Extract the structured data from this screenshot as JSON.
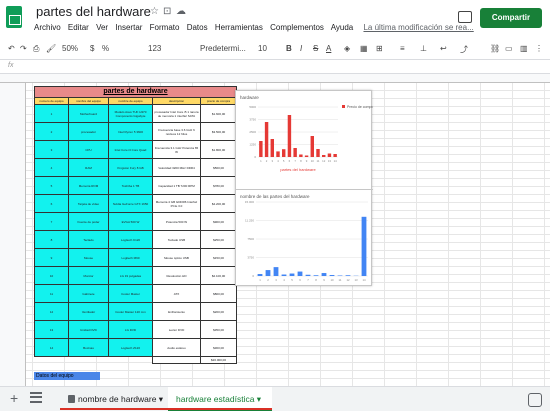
{
  "app": {
    "title": "partes del hardware",
    "share_label": "Compartir"
  },
  "menu": [
    "Archivo",
    "Editar",
    "Ver",
    "Insertar",
    "Formato",
    "Datos",
    "Herramientas",
    "Complementos",
    "Ayuda"
  ],
  "last_edit": "La última modificación se rea...",
  "toolbar": {
    "zoom": "50%",
    "currency": "$",
    "percent": "%",
    ".0": ".0",
    ".00": ".00",
    "format_num": "123",
    "font": "Predetermi...",
    "font_size": "10",
    "bold": "B",
    "italic": "I",
    "strike": "S",
    "text_color": "A"
  },
  "formula": {
    "fx": "fx",
    "value": ""
  },
  "columns": [
    "A",
    "B",
    "C",
    "D",
    "E",
    "F",
    "G",
    "H",
    "I",
    "J",
    "K",
    "L",
    "M",
    "N",
    "O",
    "P"
  ],
  "rows": [
    "1",
    "2",
    "3",
    "4",
    "5",
    "6",
    "7",
    "8",
    "9",
    "10",
    "11",
    "12",
    "13",
    "14",
    "15",
    "16",
    "17",
    "18",
    "19",
    "20",
    "21",
    "22",
    "23",
    "24",
    "25",
    "26",
    "27",
    "28",
    "29",
    "30",
    "31",
    "32",
    "33",
    "34",
    "35",
    "36",
    "37"
  ],
  "table": {
    "title": "partes de hardware",
    "headers": [
      "numero de equipo",
      "nombre del equipo",
      "nombre de equipo",
      "descripcion",
      "precio de compra"
    ],
    "rows": [
      [
        "1",
        "Motherboard",
        "Modelo Asus TUF H370 Components Gigabyte",
        "procesador Intel Core i5 1 ranura de memoria 1 interfaz SATA",
        "$1.600,00"
      ],
      [
        "2",
        "procesador",
        "Intel Ryzen 5 3600",
        "Frecuencia base 3.6 GHz 6 núcleos 12 hilos",
        "$3.500,00"
      ],
      [
        "3",
        "CPU",
        "Intel Core i3 Core Quad",
        "Frecuencia 3.1 GHz Potencia 65 W",
        "$1.800,00"
      ],
      [
        "4",
        "RAM",
        "Kingston Fury 8 GB",
        "Velocidad 3200 MHz DDR4",
        "$560,00"
      ],
      [
        "5",
        "Memoria ROM",
        "Toshiba 1 TB",
        "Capacidad 1 TB 7200 RPM",
        "$780,00"
      ],
      [
        "6",
        "Tarjeta de video",
        "Nvidia GeForce GTX 1650",
        "Memoria 4 GB GDDR6 Interfaz PCIe 3.0",
        "$4.200,00"
      ],
      [
        "7",
        "Fuente de poder",
        "EVGA 500 W",
        "Potencia 500 W",
        "$900,00"
      ],
      [
        "8",
        "Teclado",
        "Logitech K120",
        "Teclado USB",
        "$250,00"
      ],
      [
        "9",
        "Mouse",
        "Logitech M90",
        "Mouse óptico USB",
        "$150,00"
      ],
      [
        "10",
        "Monitor",
        "LG 19 pulgadas",
        "Resolución HD",
        "$2.100,00"
      ],
      [
        "11",
        "Gabinete",
        "Cooler Master",
        "ATX",
        "$800,00"
      ],
      [
        "12",
        "Ventilador",
        "Cooler Master 120 mm",
        "Enfriamiento",
        "$200,00"
      ],
      [
        "13",
        "Unidad DVD",
        "LG DVD",
        "Lector DVD",
        "$350,00"
      ],
      [
        "14",
        "Bocinas",
        "Logitech Z120",
        "Audio estéreo",
        "$300,00"
      ]
    ],
    "total": "$20.000,00"
  },
  "datos_label": "Datos del equipo",
  "chart_data": [
    {
      "type": "bar",
      "title": "hardware",
      "series": [
        {
          "name": "Precio de compra",
          "values": [
            1600,
            3500,
            1800,
            560,
            780,
            4200,
            900,
            250,
            150,
            2100,
            800,
            200,
            350,
            300
          ]
        }
      ],
      "categories": [
        "1",
        "2",
        "3",
        "4",
        "5",
        "6",
        "7",
        "8",
        "9",
        "10",
        "11",
        "12",
        "13",
        "14"
      ],
      "xlabel": "partes del hardware",
      "ylabel": "",
      "ylim": [
        0,
        5000
      ],
      "color": "#e53935"
    },
    {
      "type": "bar",
      "title": "nombre de las partes del hardware",
      "series": [
        {
          "name": "",
          "values": [
            400,
            1200,
            1800,
            300,
            500,
            900,
            250,
            150,
            600,
            200,
            100,
            150,
            50,
            12000
          ]
        }
      ],
      "categories": [
        "1",
        "2",
        "3",
        "4",
        "5",
        "6",
        "7",
        "8",
        "9",
        "10",
        "11",
        "12",
        "13",
        "14"
      ],
      "ylim": [
        0,
        15000
      ],
      "color": "#4285f4"
    }
  ],
  "sheets": [
    {
      "name": "nombre de hardware",
      "active": false
    },
    {
      "name": "hardware estadística",
      "active": true
    }
  ]
}
